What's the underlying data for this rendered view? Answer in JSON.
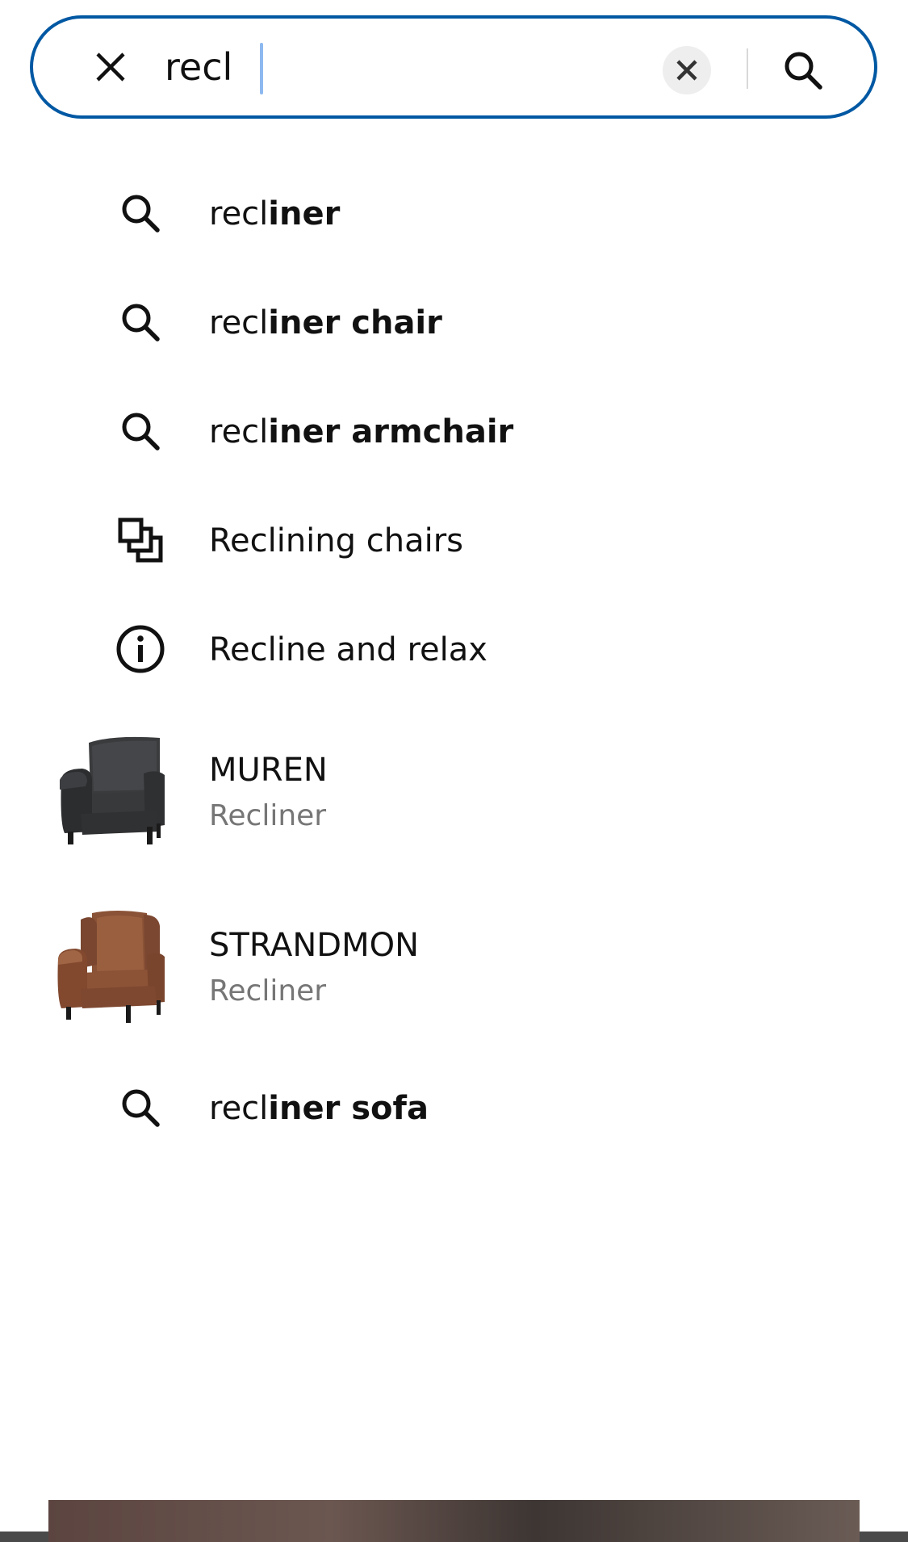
{
  "search": {
    "value": "recl",
    "icons": {
      "close": "close-icon",
      "clear": "clear-icon",
      "submit": "search-icon"
    }
  },
  "suggestions": [
    {
      "kind": "query",
      "icon": "search-icon",
      "typed": "recl",
      "completion": "iner"
    },
    {
      "kind": "query",
      "icon": "search-icon",
      "typed": "recl",
      "completion": "iner chair"
    },
    {
      "kind": "query",
      "icon": "search-icon",
      "typed": "recl",
      "completion": "iner armchair"
    },
    {
      "kind": "category",
      "icon": "category-icon",
      "label": "Reclining chairs"
    },
    {
      "kind": "content",
      "icon": "info-icon",
      "label": "Recline and relax"
    },
    {
      "kind": "product",
      "image": "dark-grey-recliner-image",
      "name": "MUREN",
      "type": "Recliner"
    },
    {
      "kind": "product",
      "image": "brown-wingback-recliner-image",
      "name": "STRANDMON",
      "type": "Recliner"
    },
    {
      "kind": "query",
      "icon": "search-icon",
      "typed": "recl",
      "completion": "iner sofa"
    }
  ],
  "colors": {
    "accent": "#0058a3",
    "text": "#111111",
    "secondary_text": "#767676",
    "clear_button_bg": "#eeeeee"
  }
}
